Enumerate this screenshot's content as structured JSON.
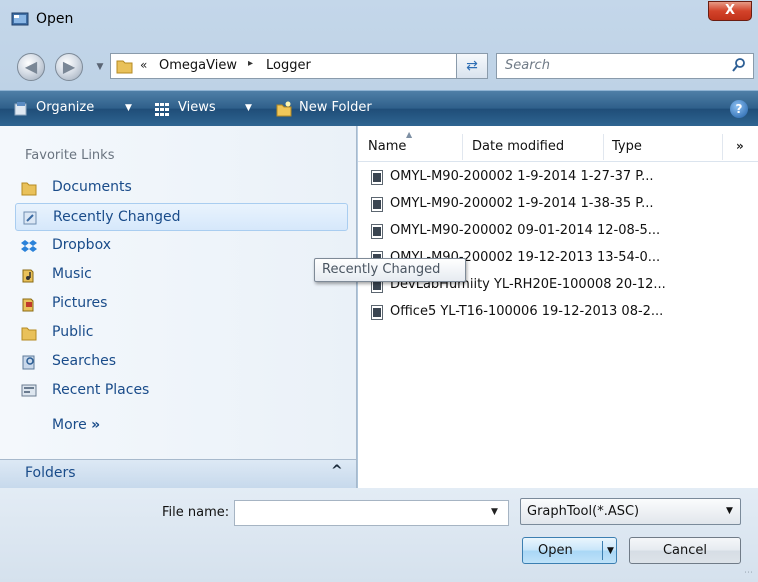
{
  "window": {
    "title": "Open",
    "close_label": "X"
  },
  "nav": {
    "breadcrumb_prefix": "«",
    "crumbs": [
      "OmegaView",
      "Logger"
    ],
    "crumb_separator": "▸",
    "search_placeholder": "Search"
  },
  "toolbar": {
    "organize_label": "Organize",
    "views_label": "Views",
    "new_folder_label": "New Folder",
    "help_label": "?"
  },
  "sidebar": {
    "favorites_title": "Favorite Links",
    "items": [
      {
        "label": "Documents",
        "icon": "documents-folder-icon"
      },
      {
        "label": "Recently Changed",
        "icon": "recently-changed-icon",
        "selected": true
      },
      {
        "label": "Dropbox",
        "icon": "dropbox-icon"
      },
      {
        "label": "Music",
        "icon": "music-icon"
      },
      {
        "label": "Pictures",
        "icon": "pictures-icon"
      },
      {
        "label": "Public",
        "icon": "public-folder-icon"
      },
      {
        "label": "Searches",
        "icon": "searches-icon"
      },
      {
        "label": "Recent Places",
        "icon": "recent-places-icon"
      }
    ],
    "more_label": "More",
    "more_arrow": "»",
    "folders_label": "Folders",
    "folders_chevron": "^"
  },
  "file_list": {
    "columns": [
      "Name",
      "Date modified",
      "Type"
    ],
    "more_columns": "»",
    "files": [
      "OMYL-M90-200002 1-9-2014 1-27-37 P...",
      "OMYL-M90-200002 1-9-2014 1-38-35 P...",
      "OMYL-M90-200002 09-01-2014 12-08-5...",
      "OMYL-M90-200002 19-12-2013 13-54-0...",
      "DevLabHumiity YL-RH20E-100008 20-12...",
      "Office5 YL-T16-100006 19-12-2013 08-2..."
    ]
  },
  "tooltip": {
    "text": "Recently Changed"
  },
  "footer": {
    "file_name_label": "File name:",
    "file_name_value": "",
    "filter_value": "GraphTool(*.ASC)",
    "open_label": "Open",
    "cancel_label": "Cancel"
  }
}
